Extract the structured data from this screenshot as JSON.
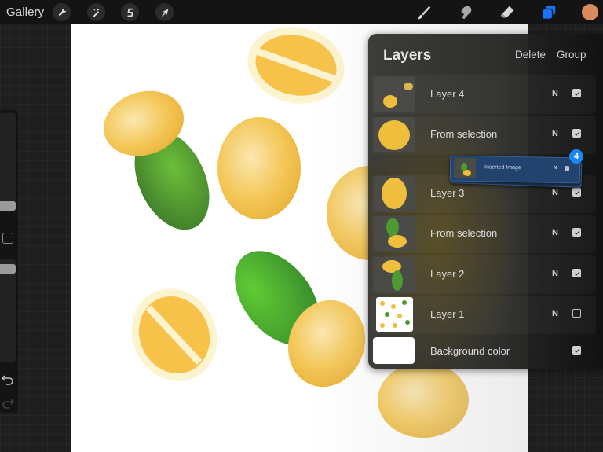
{
  "toolbar": {
    "gallery_label": "Gallery",
    "left_tools": [
      {
        "name": "actions",
        "icon": "wrench-icon"
      },
      {
        "name": "adjustments",
        "icon": "magic-wand-icon"
      },
      {
        "name": "selection",
        "icon": "selection-s-icon"
      },
      {
        "name": "transform",
        "icon": "arrow-cursor-icon"
      }
    ],
    "right_tools": [
      {
        "name": "brush",
        "icon": "brush-icon"
      },
      {
        "name": "smudge",
        "icon": "smudge-finger-icon"
      },
      {
        "name": "eraser",
        "icon": "eraser-icon"
      },
      {
        "name": "layers",
        "icon": "layers-icon",
        "active": true
      }
    ],
    "accent_color": "#1a73ff",
    "current_color": "#d98a5e"
  },
  "layers_panel": {
    "title": "Layers",
    "delete_label": "Delete",
    "group_label": "Group",
    "layers": [
      {
        "name": "Layer 4",
        "blend": "N",
        "visible": true
      },
      {
        "name": "From selection",
        "blend": "N",
        "visible": true
      },
      {
        "name": "Layer 3",
        "blend": "N",
        "visible": true
      },
      {
        "name": "From selection",
        "blend": "N",
        "visible": true
      },
      {
        "name": "Layer 2",
        "blend": "N",
        "visible": true
      },
      {
        "name": "Layer 1",
        "blend": "N",
        "visible": false
      },
      {
        "name": "Background color",
        "blend": "",
        "visible": true
      }
    ]
  },
  "drag_item": {
    "name": "Inserted Image",
    "blend": "N",
    "count": "4"
  },
  "sidebar": {
    "brush_size_thumb": "top",
    "opacity_thumb": "middle"
  }
}
